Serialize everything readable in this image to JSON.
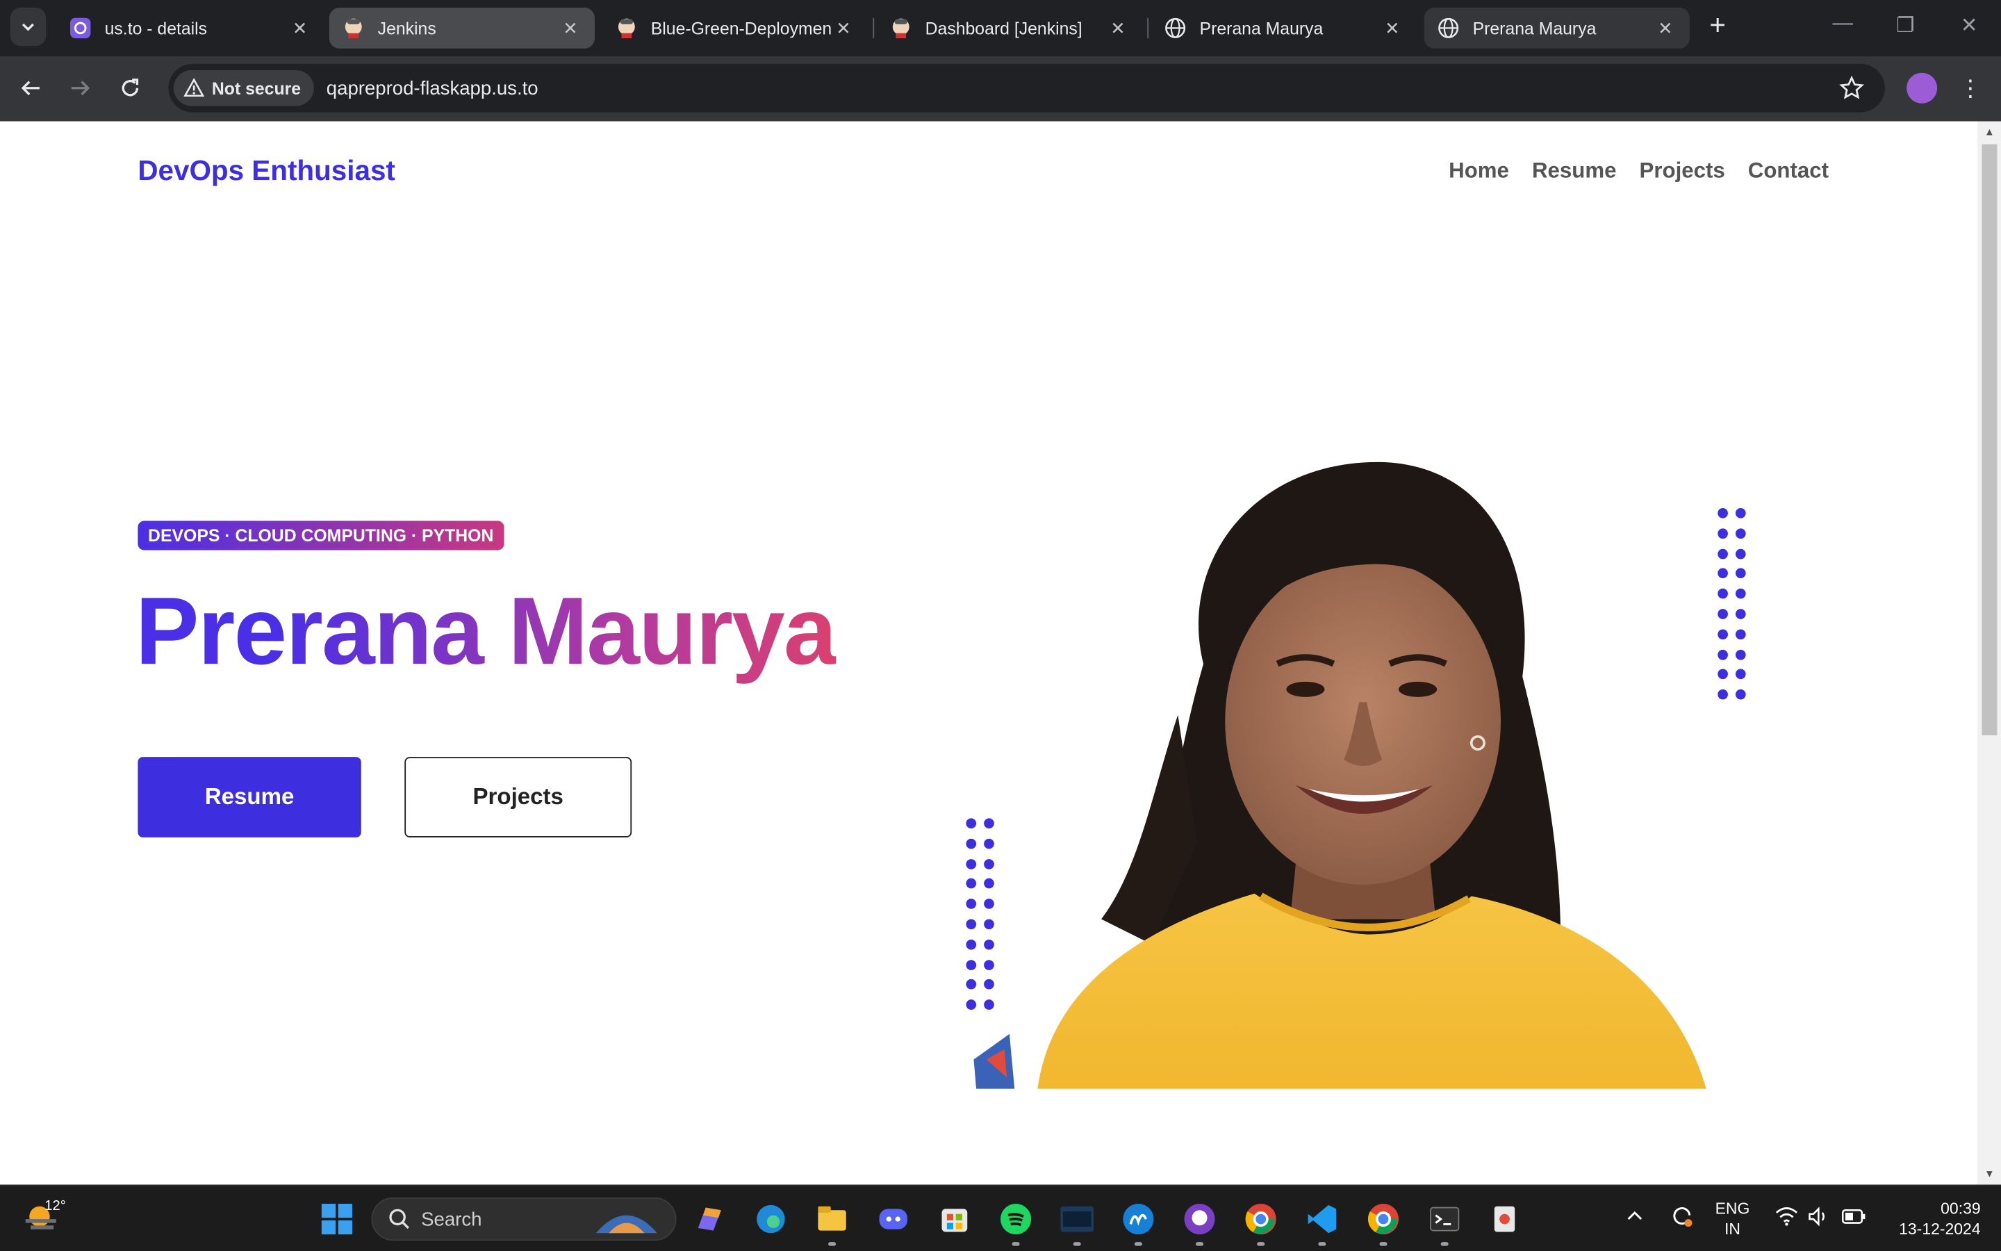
{
  "browser": {
    "tabs": [
      {
        "title": "us.to - details",
        "favicon": "purple-app-icon",
        "state": "inactive"
      },
      {
        "title": "Jenkins",
        "favicon": "jenkins-icon",
        "state": "hover"
      },
      {
        "title": "Blue-Green-Deploymen",
        "favicon": "jenkins-icon",
        "state": "inactive"
      },
      {
        "title": "Dashboard [Jenkins]",
        "favicon": "jenkins-icon",
        "state": "inactive"
      },
      {
        "title": "Prerana Maurya",
        "favicon": "globe-icon",
        "state": "inactive"
      },
      {
        "title": "Prerana Maurya",
        "favicon": "globe-icon",
        "state": "active"
      }
    ],
    "security_chip": "Not secure",
    "url": "qapreprod-flaskapp.us.to"
  },
  "site": {
    "brand": "DevOps Enthusiast",
    "nav": [
      "Home",
      "Resume",
      "Projects",
      "Contact"
    ],
    "tagline": "DEVOPS · CLOUD COMPUTING · PYTHON",
    "name": "Prerana Maurya",
    "primary_button": "Resume",
    "secondary_button": "Projects",
    "accent_color": "#3d2fe0"
  },
  "taskbar": {
    "weather_temp": "12°",
    "search_placeholder": "Search",
    "language_line1": "ENG",
    "language_line2": "IN",
    "time": "00:39",
    "date": "13-12-2024"
  }
}
